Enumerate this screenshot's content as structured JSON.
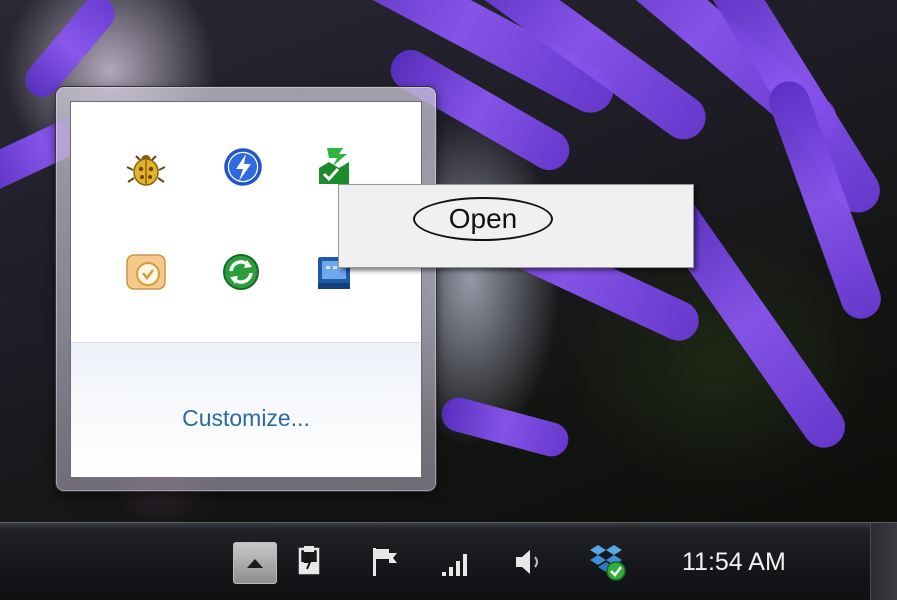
{
  "tray_popup": {
    "icons": [
      {
        "name": "bug-icon"
      },
      {
        "name": "lightning-icon"
      },
      {
        "name": "green-update-icon"
      },
      {
        "name": "chat-icon"
      },
      {
        "name": "sync-icon"
      },
      {
        "name": "blue-monitor-icon"
      }
    ],
    "customize_label": "Customize..."
  },
  "context_menu": {
    "items": [
      {
        "label": "Open",
        "highlighted": true
      }
    ]
  },
  "taskbar": {
    "show_hidden_icon": "triangle-up-icon",
    "tray_icons": [
      "power-icon",
      "flag-icon",
      "signal-bars-icon",
      "speaker-icon",
      "dropbox-icon"
    ],
    "clock": "11:54 AM"
  },
  "colors": {
    "link": "#2a6aa3",
    "taskbar": "#151619",
    "menu_bg": "#f0f0f0"
  }
}
